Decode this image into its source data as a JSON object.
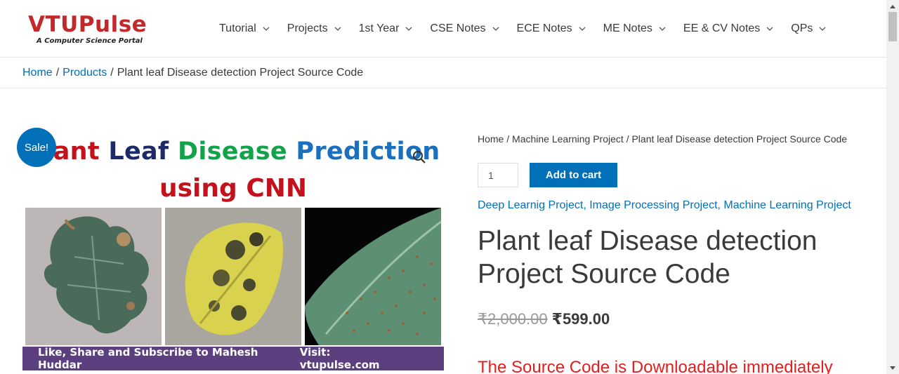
{
  "logo": {
    "name": "VTUPulse",
    "tagline": "A Computer Science Portal"
  },
  "nav": [
    {
      "label": "Tutorial"
    },
    {
      "label": "Projects"
    },
    {
      "label": "1st Year"
    },
    {
      "label": "CSE Notes"
    },
    {
      "label": "ECE Notes"
    },
    {
      "label": "ME Notes"
    },
    {
      "label": "EE & CV Notes"
    },
    {
      "label": "QPs"
    }
  ],
  "breadcrumb": {
    "home": "Home",
    "products": "Products",
    "current": "Plant leaf Disease detection Project Source Code"
  },
  "product_image": {
    "title_w1": "Plant",
    "title_w2": "Leaf",
    "title_w3": "Disease",
    "title_w4": "Prediction",
    "title_line2": "using CNN",
    "footer_left": "Like, Share and Subscribe to Mahesh Huddar",
    "footer_right": "Visit: vtupulse.com"
  },
  "sale_badge": "Sale!",
  "summary": {
    "crumb_home": "Home",
    "crumb_cat": "Machine Learning Project",
    "crumb_current": "Plant leaf Disease detection Project Source Code",
    "quantity": "1",
    "add_to_cart": "Add to cart",
    "categories": [
      "Deep Learnig Project",
      "Image Processing Project",
      "Machine Learning Project"
    ],
    "title": "Plant leaf Disease detection Project Source Code",
    "old_price": "₹2,000.00",
    "new_price": "₹599.00",
    "notice": "The Source Code is Downloadable immediately"
  },
  "colors": {
    "accent": "#0170b9",
    "logo": "#c4282b",
    "notice": "#e41d1d"
  }
}
